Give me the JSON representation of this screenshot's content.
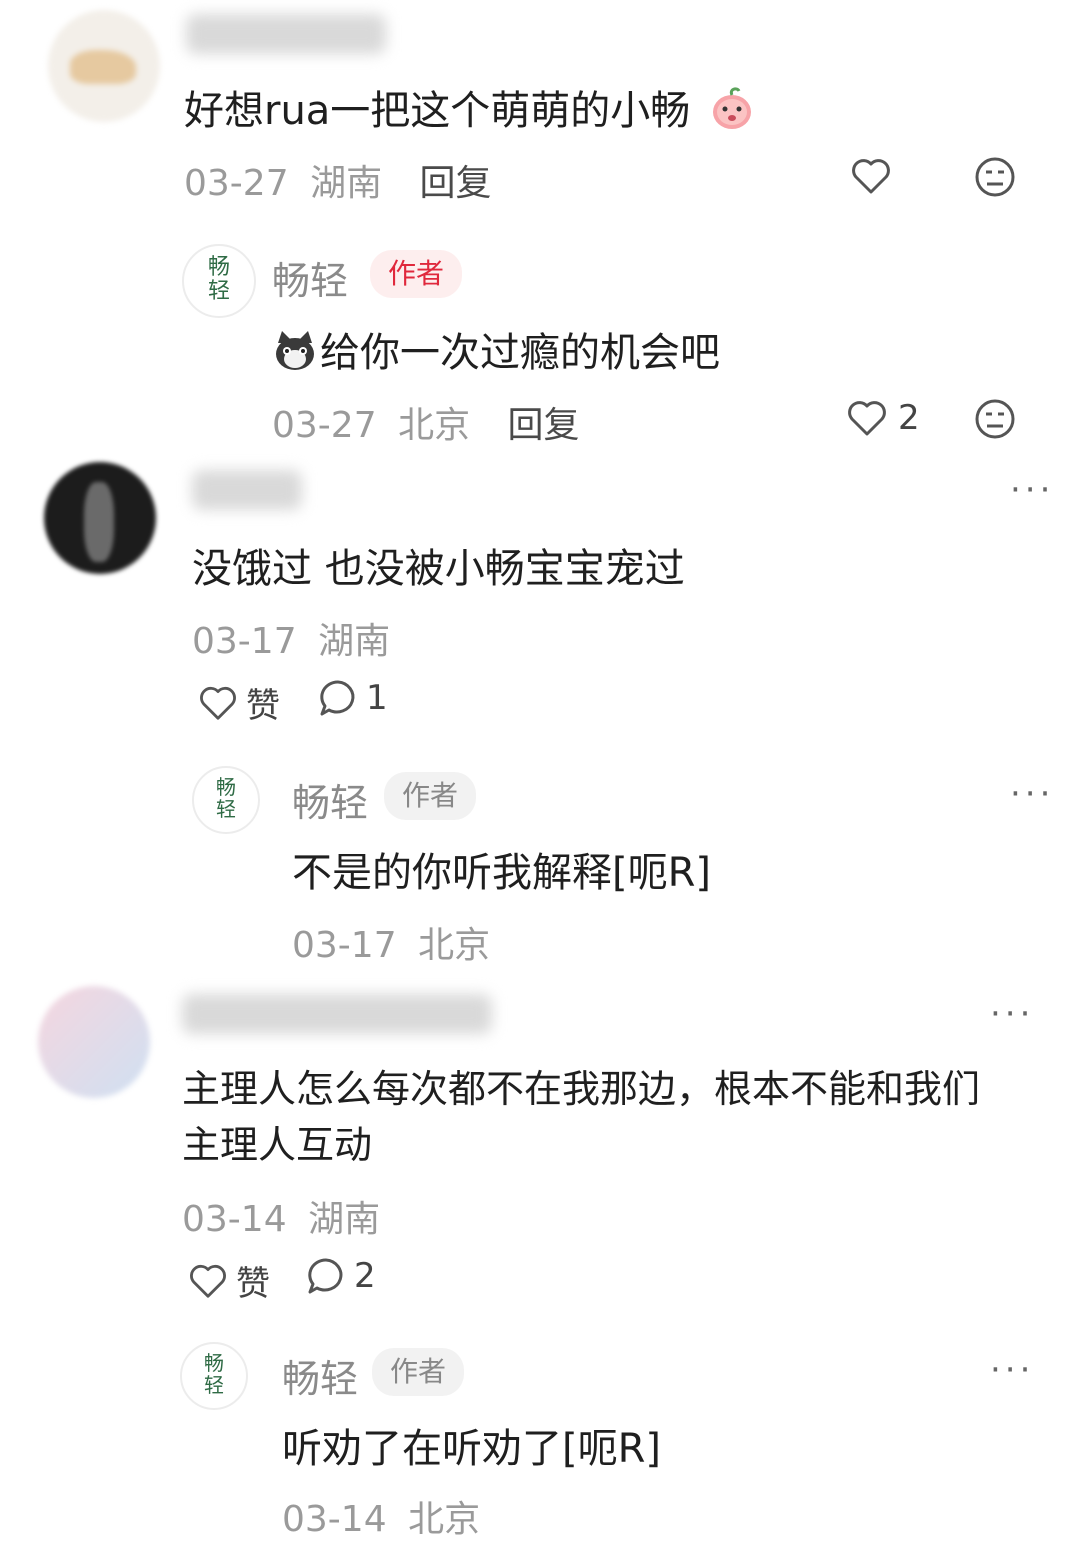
{
  "comments": [
    {
      "text": "好想rua一把这个萌萌的小畅",
      "date": "03-27",
      "region": "湖南",
      "reply_label": "回复",
      "replies": [
        {
          "author": "畅轻",
          "badge": "作者",
          "text": "给你一次过瘾的机会吧",
          "date": "03-27",
          "region": "北京",
          "reply_label": "回复",
          "likes": "2"
        }
      ]
    },
    {
      "text": "没饿过 也没被小畅宝宝宠过",
      "date": "03-17",
      "region": "湖南",
      "like_label": "赞",
      "reply_count": "1",
      "replies": [
        {
          "author": "畅轻",
          "badge": "作者",
          "text": "不是的你听我解释[呃R]",
          "date": "03-17",
          "region": "北京"
        }
      ]
    },
    {
      "text_line1": "主理人怎么每次都不在我那边，根本不能和我们",
      "text_line2": "主理人互动",
      "date": "03-14",
      "region": "湖南",
      "like_label": "赞",
      "reply_count": "2",
      "replies": [
        {
          "author": "畅轻",
          "badge": "作者",
          "text": "听劝了在听劝了[呃R]",
          "date": "03-14",
          "region": "北京"
        }
      ]
    }
  ],
  "colors": {
    "author_badge_red": "#e0283c",
    "meta_gray": "#9a9a9a",
    "logo_green": "#2f6b45"
  },
  "icons": [
    "heart-outline-icon",
    "meh-face-icon",
    "comment-bubble-icon",
    "more-dots-icon",
    "cat-emoji-icon",
    "peach-emoji-icon"
  ]
}
